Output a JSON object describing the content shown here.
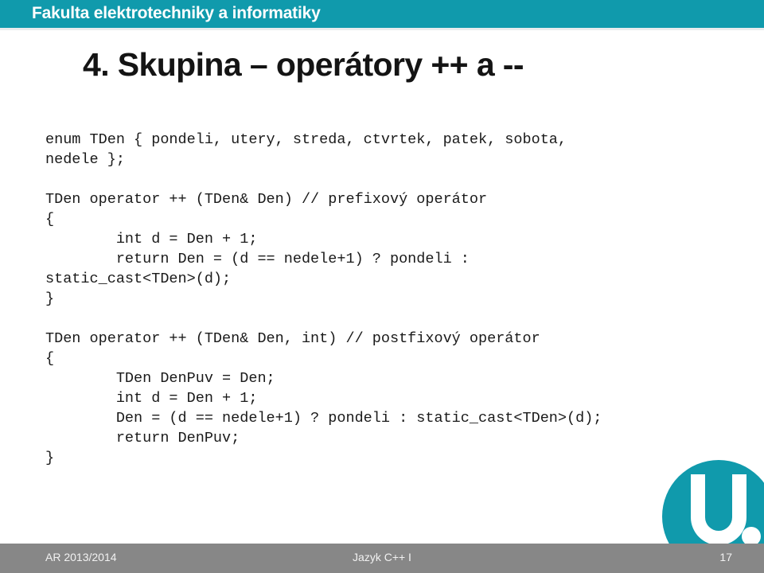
{
  "header": {
    "faculty_title": "Fakulta elektrotechniky a informatiky",
    "band_color": "#109aac"
  },
  "slide": {
    "title": "4. Skupina – operátory ++ a --",
    "code_lines": [
      "enum TDen { pondeli, utery, streda, ctvrtek, patek, sobota,",
      "nedele };",
      "",
      "TDen operator ++ (TDen& Den) // prefixový operátor",
      "{",
      "        int d = Den + 1;",
      "        return Den = (d == nedele+1) ? pondeli :",
      "static_cast<TDen>(d);",
      "}",
      "",
      "TDen operator ++ (TDen& Den, int) // postfixový operátor",
      "{",
      "        TDen DenPuv = Den;",
      "        int d = Den + 1;",
      "        Den = (d == nedele+1) ? pondeli : static_cast<TDen>(d);",
      "        return DenPuv;",
      "}"
    ]
  },
  "logo": {
    "name": "university-u-logo",
    "circle_color": "#109aac",
    "letter": "U"
  },
  "footer": {
    "left": "AR 2013/2014",
    "center": "Jazyk C++ I",
    "page_number": "17",
    "bar_color": "#878787"
  }
}
